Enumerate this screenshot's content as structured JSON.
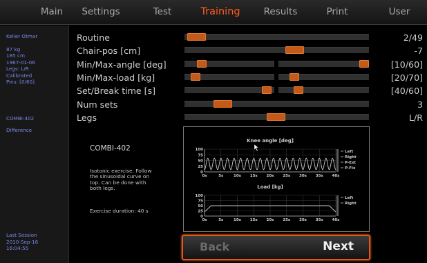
{
  "nav": {
    "tabs": [
      {
        "label": "Main"
      },
      {
        "label": "Settings"
      },
      {
        "label": "Test"
      },
      {
        "label": "Training"
      },
      {
        "label": "Results"
      },
      {
        "label": "Print"
      },
      {
        "label": "User"
      }
    ],
    "active": "Training"
  },
  "sidebar": {
    "user_name": "Keller Otmar",
    "user_details": "87 kg\n185 cm\n1967-01-06\nLegs: L/R\nCalibrated\nPins: [0/60]",
    "device": "COMBI-402",
    "mode": "Difference",
    "last_session_label": "Last Session",
    "last_session": "2010-Sep-16\n16:04:55"
  },
  "params": [
    {
      "label": "Routine",
      "value": "2/49"
    },
    {
      "label": "Chair-pos [cm]",
      "value": "-7"
    },
    {
      "label": "Min/Max-angle [deg]",
      "value": "[10/60]"
    },
    {
      "label": "Min/Max-load [kg]",
      "value": "[20/70]"
    },
    {
      "label": "Set/Break time [s]",
      "value": "[40/60]"
    },
    {
      "label": "Num sets",
      "value": "3"
    },
    {
      "label": "Legs",
      "value": "L/R"
    }
  ],
  "panel": {
    "title": "COMBI-402",
    "description": "Isotonic exercise. Follow\nthe sinusoidal curve on\ntop. Can be done with\nboth legs.",
    "duration": "Exercise duration: 40 s"
  },
  "chart_data": [
    {
      "type": "line",
      "title": "Knee angle [deg]",
      "x_ticks": [
        "0s",
        "5s",
        "10s",
        "15s",
        "20s",
        "25s",
        "30s",
        "35s",
        "40s"
      ],
      "y_ticks": [
        "100",
        "75",
        "50",
        "25",
        "0"
      ],
      "xlim": [
        0,
        40
      ],
      "ylim": [
        0,
        100
      ],
      "legend": [
        "Left",
        "Right",
        "P-Ext",
        "P-Flx"
      ],
      "series": [
        {
          "name": "curve",
          "description": "sinusoid between 10 and 60 deg, ~20 cycles over 40 s",
          "min": 10,
          "max": 60,
          "cycles": 20
        }
      ]
    },
    {
      "type": "line",
      "title": "Load [kg]",
      "x_ticks": [
        "0s",
        "5s",
        "10s",
        "15s",
        "20s",
        "25s",
        "30s",
        "35s",
        "40s"
      ],
      "y_ticks": [
        "100",
        "75",
        "50",
        "25",
        "0"
      ],
      "xlim": [
        0,
        40
      ],
      "ylim": [
        0,
        100
      ],
      "legend": [
        "Left",
        "Right"
      ],
      "series": [
        {
          "name": "load",
          "x": [
            0,
            2,
            38,
            40
          ],
          "y": [
            20,
            50,
            50,
            20
          ]
        }
      ]
    }
  ],
  "buttons": {
    "back": "Back",
    "next": "Next"
  },
  "colors": {
    "accent": "#ff5a1e",
    "handle": "#c45a1a",
    "sidebar_text": "#7c86e6",
    "curve": "#c8c8c8"
  }
}
